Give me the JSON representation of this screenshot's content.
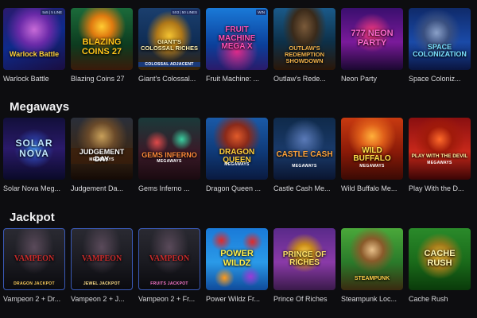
{
  "sections": [
    {
      "title": ""
    },
    {
      "title": "Megaways"
    },
    {
      "title": "Jackpot"
    }
  ],
  "row1": [
    {
      "title": "Warlock Battle",
      "logo": "Warlock Battle",
      "badge": "5x5 | 5 LINE"
    },
    {
      "title": "Blazing Coins 27",
      "logo": "BLAZING COINS 27"
    },
    {
      "title": "Giant's Colossal...",
      "logo": "GIANT'S COLOSSAL RICHES",
      "badge": "5X3 | 50 LINES",
      "sub": "COLOSSAL ADJACENT"
    },
    {
      "title": "Fruit Machine: ...",
      "logo": "FRUIT MACHINE MEGA X",
      "badge": "WIN"
    },
    {
      "title": "Outlaw's Rede...",
      "logo": "OUTLAW'S REDEMPTION SHOWDOWN"
    },
    {
      "title": "Neon Party",
      "logo": "777 NEON PARTY"
    },
    {
      "title": "Space Coloniz...",
      "logo": "SPACE COLONIZATION"
    }
  ],
  "row2": [
    {
      "title": "Solar Nova Meg...",
      "logo": "SOLAR NOVA"
    },
    {
      "title": "Judgement Da...",
      "logo": "JUDGEMENT DAY",
      "sub": "MEGAWAYS"
    },
    {
      "title": "Gems Inferno ...",
      "logo": "GEMS INFERNO",
      "sub": "MEGAWAYS"
    },
    {
      "title": "Dragon Queen ...",
      "logo": "DRAGON QUEEN",
      "sub": "MEGAWAYS"
    },
    {
      "title": "Castle Cash Me...",
      "logo": "CASTLE CASH",
      "sub": "MEGAWAYS"
    },
    {
      "title": "Wild Buffalo Me...",
      "logo": "WILD BUFFALO",
      "sub": "MEGAWAYS"
    },
    {
      "title": "Play With the D...",
      "logo": "PLAY WITH THE DEVIL",
      "sub": "MEGAWAYS"
    }
  ],
  "row3": [
    {
      "title": "Vampeon 2 + Dr...",
      "logo": "VAMPEON",
      "sub": "DRAGON JACKPOT"
    },
    {
      "title": "Vampeon 2 + J...",
      "logo": "VAMPEON",
      "sub": "JEWEL JACKPOT"
    },
    {
      "title": "Vampeon 2 + Fr...",
      "logo": "VAMPEON",
      "sub": "FRUITS JACKPOT"
    },
    {
      "title": "Power Wildz Fr...",
      "logo": "POWER WILDZ"
    },
    {
      "title": "Prince Of Riches",
      "logo": "PRINCE OF RICHES"
    },
    {
      "title": "Steampunk Loc...",
      "logo": "STEAMPUNK"
    },
    {
      "title": "Cache Rush",
      "logo": "CACHE RUSH"
    }
  ],
  "colors": {
    "background": "#0d0d10",
    "title_text": "#d9d9dc",
    "section_text": "#f2f2f4"
  }
}
